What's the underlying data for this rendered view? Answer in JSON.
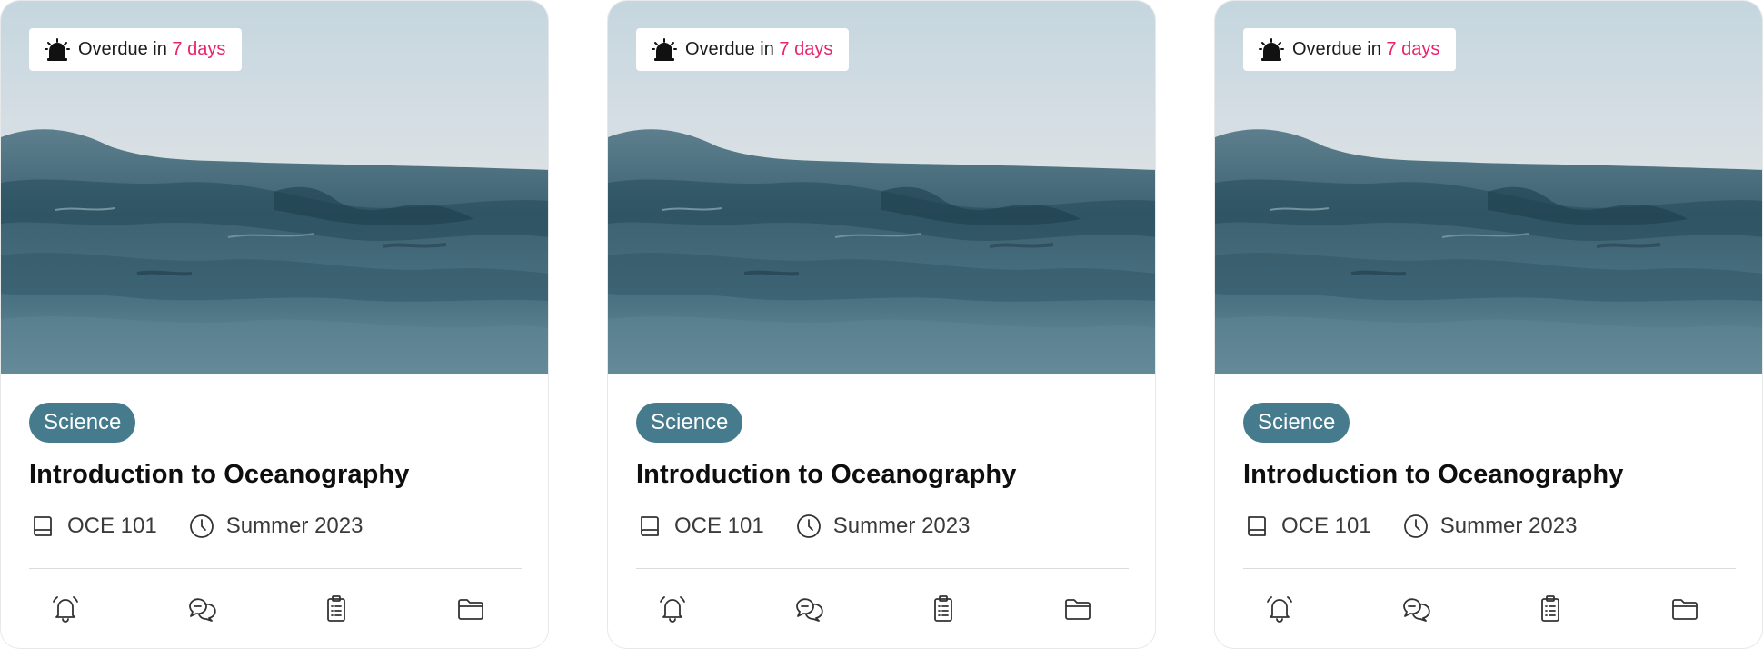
{
  "cards": [
    {
      "overdue_prefix": "Overdue in",
      "overdue_days": "7 days",
      "tag": "Science",
      "title": "Introduction to Oceanography",
      "course_code": "OCE 101",
      "term": "Summer 2023"
    },
    {
      "overdue_prefix": "Overdue in",
      "overdue_days": "7 days",
      "tag": "Science",
      "title": "Introduction to Oceanography",
      "course_code": "OCE 101",
      "term": "Summer 2023"
    },
    {
      "overdue_prefix": "Overdue in",
      "overdue_days": "7 days",
      "tag": "Science",
      "title": "Introduction to Oceanography",
      "course_code": "OCE 101",
      "term": "Summer 2023"
    }
  ],
  "icons": {
    "overdue": "siren-icon",
    "course_code": "book-icon",
    "term": "clock-icon",
    "actions": [
      "bell-icon",
      "chat-icon",
      "clipboard-icon",
      "folder-icon"
    ]
  },
  "colors": {
    "tag_background": "#457b8d",
    "overdue_accent": "#e8246b",
    "card_border": "#e6e8ea"
  }
}
